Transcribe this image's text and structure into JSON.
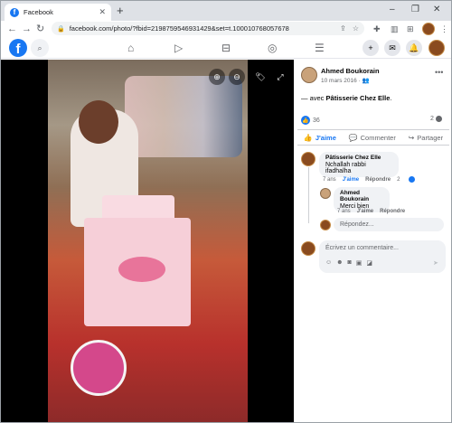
{
  "browser": {
    "tab_title": "Facebook",
    "tab_favicon": "f",
    "new_tab": "+",
    "url": "facebook.com/photo/?fbid=2198759546931429&set=t.100010768057678",
    "window_controls": [
      "–",
      "❐",
      "✕"
    ]
  },
  "fb": {
    "logo": "f",
    "nav_icons": [
      "home-icon",
      "watch-icon",
      "marketplace-icon",
      "groups-icon",
      "menu-icon"
    ]
  },
  "post": {
    "owner": "Ahmed Boukorain",
    "date": "10 mars 2016",
    "privacy_icon": "friends-icon",
    "with_prefix": "— avec",
    "with_name": "Pâtisserie Chez Elle",
    "with_suffix": ".",
    "like_count": "36",
    "comment_count": "2",
    "actions": {
      "like": "J'aime",
      "comment": "Commenter",
      "share": "Partager"
    }
  },
  "comments": [
    {
      "author": "Pâtisserie Chez Elle",
      "text": "Nchallah rabbi ifadhalha",
      "time": "7 ans",
      "like": "J'aime",
      "reply": "Répondre",
      "reactions": "2"
    },
    {
      "author": "Ahmed Boukorain",
      "text": "Merci bien",
      "time": "7 ans",
      "like": "J'aime",
      "reply": "Répondre"
    }
  ],
  "reply_placeholder": "Répondez...",
  "comment_placeholder": "Écrivez un commentaire...",
  "colors": {
    "fb_blue": "#1877f2",
    "bubble_bg": "#f0f2f5",
    "text_secondary": "#65676b"
  }
}
